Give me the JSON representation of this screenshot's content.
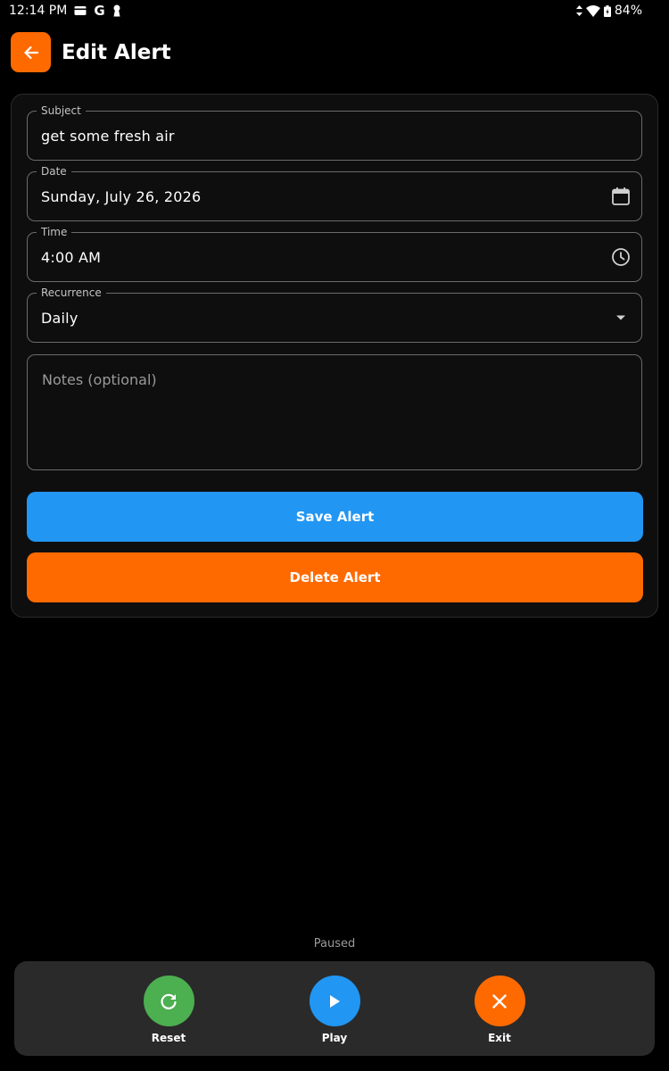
{
  "status_bar": {
    "time": "12:14 PM",
    "google_glyph": "G",
    "battery": "84%"
  },
  "header": {
    "title": "Edit Alert"
  },
  "form": {
    "subject": {
      "label": "Subject",
      "value": "get some fresh air"
    },
    "date": {
      "label": "Date",
      "value": "Sunday, July 26, 2026",
      "icon": "calendar-icon"
    },
    "time": {
      "label": "Time",
      "value": "4:00 AM",
      "icon": "clock-icon"
    },
    "recurrence": {
      "label": "Recurrence",
      "value": "Daily",
      "icon": "dropdown-arrow-icon"
    },
    "notes": {
      "placeholder": "Notes (optional)"
    },
    "save_label": "Save Alert",
    "delete_label": "Delete Alert"
  },
  "player": {
    "status": "Paused",
    "reset_label": "Reset",
    "play_label": "Play",
    "exit_label": "Exit"
  },
  "colors": {
    "accent_orange": "#FF6A00",
    "save_blue": "#2196F3",
    "reset_green": "#4CAF50",
    "background": "#000000"
  }
}
